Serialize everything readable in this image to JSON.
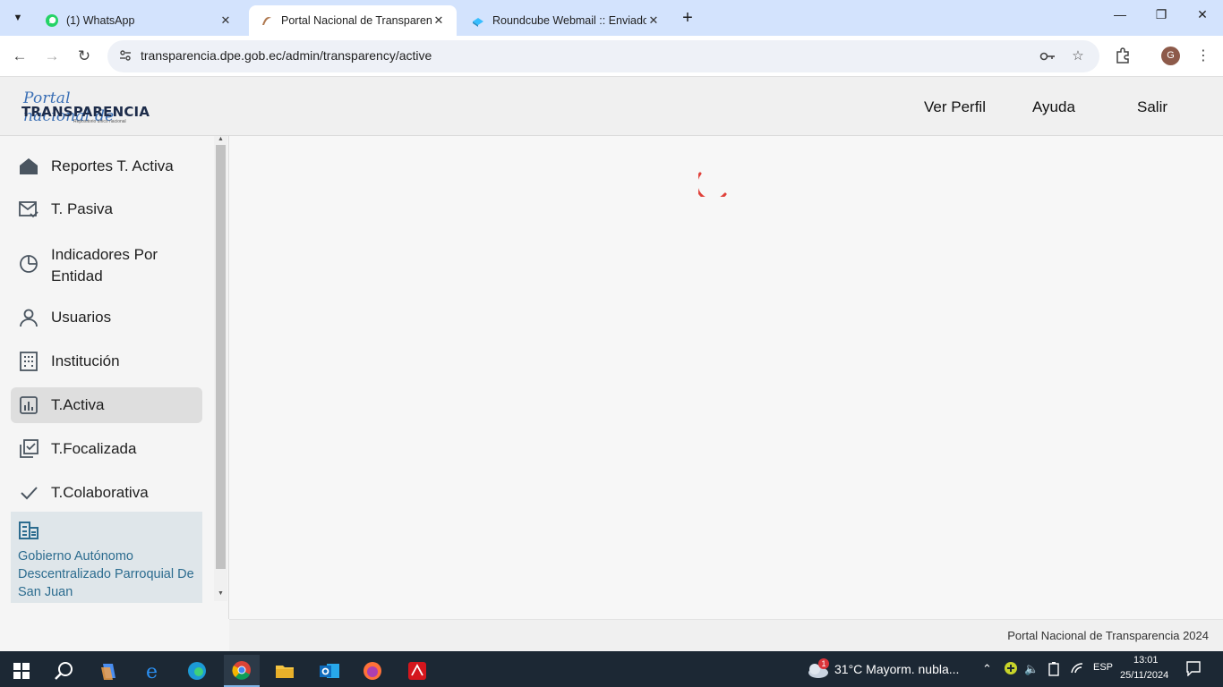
{
  "browser": {
    "tabs": [
      {
        "title": "(1) WhatsApp",
        "favicon": "whatsapp-icon"
      },
      {
        "title": "Portal Nacional de Transparencia",
        "favicon": "portal-icon"
      },
      {
        "title": "Roundcube Webmail :: Enviados",
        "favicon": "roundcube-icon"
      }
    ],
    "url": "transparencia.dpe.gob.ec/admin/transparency/active",
    "profile_initial": "G"
  },
  "header": {
    "logo_script": "Portal nacional de",
    "logo_big": "TRANSPARENCIA",
    "logo_small": "Repositorio único nacional",
    "links": [
      "Ver Perfil",
      "Ayuda",
      "Salir"
    ]
  },
  "sidebar": {
    "items": [
      {
        "label": "Reportes T. Activa",
        "icon": "home-icon"
      },
      {
        "label": "T. Pasiva",
        "icon": "mail-check-icon"
      },
      {
        "label": "Indicadores Por Entidad",
        "icon": "clock-icon"
      },
      {
        "label": "Usuarios",
        "icon": "user-icon"
      },
      {
        "label": "Institución",
        "icon": "building-icon"
      },
      {
        "label": "T.Activa",
        "icon": "chart-icon"
      },
      {
        "label": "T.Focalizada",
        "icon": "focus-check-icon"
      },
      {
        "label": "T.Colaborativa",
        "icon": "check-icon"
      }
    ],
    "active_index": 5,
    "institution": "Gobierno Autónomo Descentralizado Parroquial De San Juan"
  },
  "main": {
    "loading": true
  },
  "footer": {
    "text": "Portal Nacional de Transparencia 2024"
  },
  "taskbar": {
    "weather": "31°C  Mayorm. nubla...",
    "weather_badge": "1",
    "lang": "ESP",
    "time": "13:01",
    "date": "25/11/2024"
  },
  "colors": {
    "accent": "#2c6c8f",
    "spinner": "#e0413a",
    "tabbar": "#d3e3fd"
  }
}
